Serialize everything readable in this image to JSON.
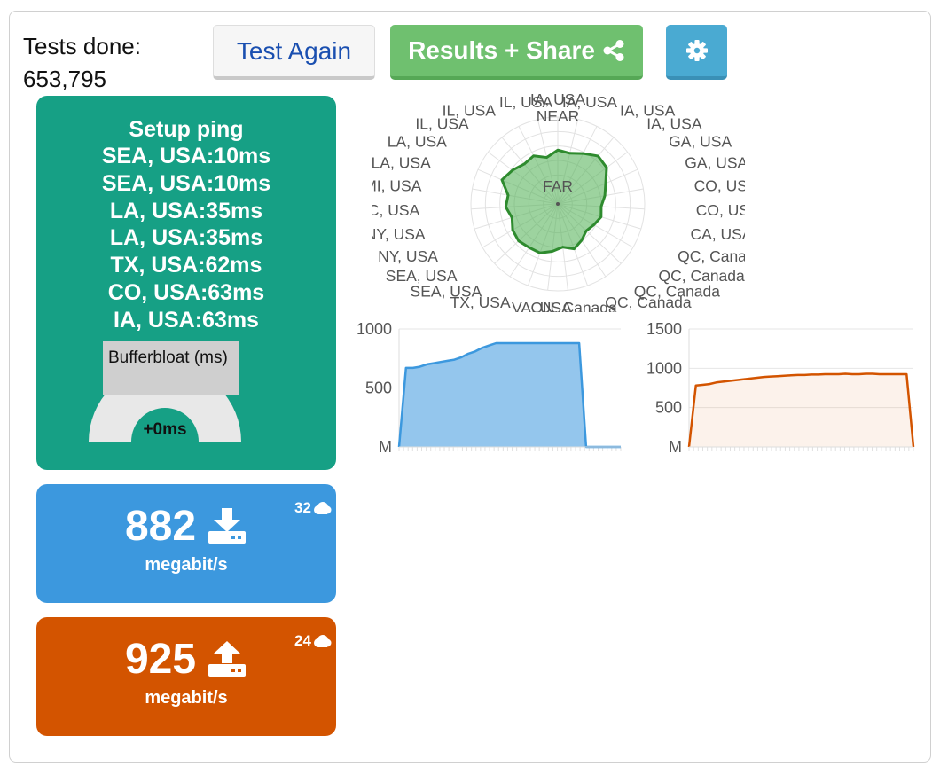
{
  "header": {
    "tests_done_label": "Tests done:",
    "tests_done_value": "653,795",
    "test_again_label": "Test Again",
    "results_share_label": "Results + Share",
    "icons": {
      "share": "share-icon",
      "settings": "gear-icon"
    }
  },
  "ping": {
    "title": "Setup ping",
    "entries": [
      "SEA, USA:10ms",
      "SEA, USA:10ms",
      "LA, USA:35ms",
      "LA, USA:35ms",
      "TX, USA:62ms",
      "CO, USA:63ms",
      "IA, USA:63ms"
    ],
    "bufferbloat_label": "Bufferbloat (ms)",
    "bufferbloat_value": "+0ms"
  },
  "download": {
    "value": "882",
    "unit": "megabit/s",
    "streams": "32",
    "icon": "download-icon",
    "stream_icon": "cloud-icon"
  },
  "upload": {
    "value": "925",
    "unit": "megabit/s",
    "streams": "24",
    "icon": "upload-icon",
    "stream_icon": "cloud-icon"
  },
  "colors": {
    "ping": "#16a085",
    "download": "#3c98de",
    "upload": "#d35400",
    "results": "#6fc06f",
    "settings": "#4aaad2",
    "radar": "#4caf50"
  },
  "chart_data": [
    {
      "type": "radar",
      "center_labels": [
        "NEAR",
        "FAR"
      ],
      "labels": [
        "VA, USA",
        "TX, USA",
        "SEA, USA",
        "SEA, USA",
        "NY, USA",
        "NY, USA",
        "NC, USA",
        "MI, USA",
        "LA, USA",
        "LA, USA",
        "IL, USA",
        "IL, USA",
        "IL, USA",
        "IA, USA",
        "IA, USA",
        "IA, USA",
        "IA, USA",
        "GA, USA",
        "GA, USA",
        "CO, USA",
        "CO, USA",
        "CA, USA",
        "QC, Canada",
        "QC, Canada",
        "QC, Canada",
        "QC, Canada",
        "ON, Canada"
      ],
      "values": [
        0.62,
        0.6,
        0.65,
        0.72,
        0.7,
        0.6,
        0.55,
        0.5,
        0.52,
        0.48,
        0.45,
        0.5,
        0.55,
        0.5,
        0.55,
        0.6,
        0.6,
        0.62,
        0.6,
        0.55,
        0.6,
        0.58,
        0.7,
        0.65,
        0.6,
        0.62,
        0.55
      ],
      "grid": true
    },
    {
      "type": "area",
      "series_color": "#3c98de",
      "yticks": [
        "1000",
        "500",
        "M"
      ],
      "ylim": [
        0,
        1000
      ],
      "values": [
        0,
        670,
        670,
        680,
        700,
        710,
        720,
        730,
        740,
        760,
        790,
        810,
        840,
        860,
        880,
        880,
        880,
        880,
        880,
        880,
        880,
        880,
        880,
        880,
        880,
        880,
        880,
        0,
        0,
        0,
        0,
        0,
        0
      ],
      "grid": true
    },
    {
      "type": "area",
      "series_color": "#d35400",
      "yticks": [
        "1500",
        "1000",
        "500",
        "M"
      ],
      "ylim": [
        0,
        1500
      ],
      "values": [
        0,
        780,
        790,
        800,
        820,
        830,
        840,
        850,
        860,
        870,
        880,
        890,
        895,
        900,
        905,
        910,
        915,
        915,
        920,
        920,
        925,
        925,
        925,
        930,
        925,
        925,
        930,
        930,
        925,
        925,
        925,
        925,
        925,
        0
      ],
      "grid": true
    }
  ]
}
